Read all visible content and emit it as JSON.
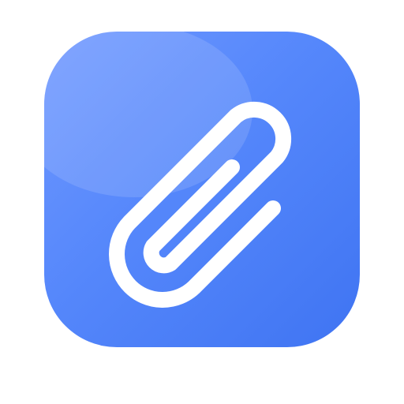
{
  "icon": {
    "name": "paperclip-icon",
    "colors": {
      "tile_top": "#6f98ff",
      "tile_mid": "#5587fb",
      "tile_bottom": "#3f74f2",
      "highlight": "#ffffff",
      "glyph": "#ffffff"
    }
  }
}
